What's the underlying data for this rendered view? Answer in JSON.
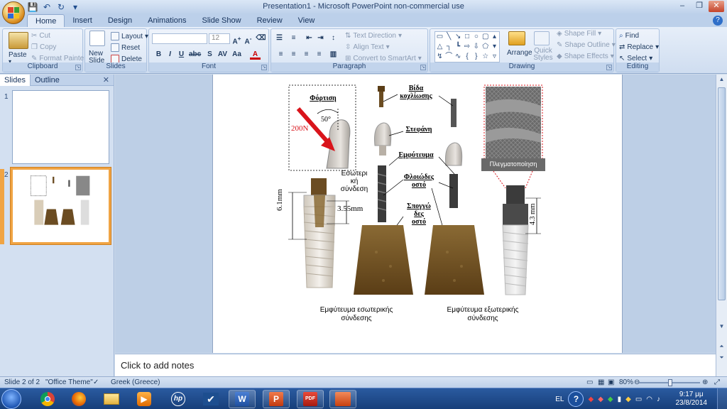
{
  "window": {
    "title": "Presentation1 - Microsoft PowerPoint non-commercial use"
  },
  "tabs": [
    "Home",
    "Insert",
    "Design",
    "Animations",
    "Slide Show",
    "Review",
    "View"
  ],
  "ribbon": {
    "clipboard": {
      "label": "Clipboard",
      "paste": "Paste",
      "cut": "Cut",
      "copy": "Copy",
      "format_painter": "Format Painter"
    },
    "slides": {
      "label": "Slides",
      "new_slide": "New Slide",
      "layout": "Layout",
      "reset": "Reset",
      "delete": "Delete"
    },
    "font": {
      "label": "Font",
      "size": "12"
    },
    "paragraph": {
      "label": "Paragraph",
      "text_direction": "Text Direction",
      "align_text": "Align Text",
      "convert_smartart": "Convert to SmartArt"
    },
    "drawing": {
      "label": "Drawing",
      "arrange": "Arrange",
      "quick_styles": "Quick Styles",
      "shape_fill": "Shape Fill",
      "shape_outline": "Shape Outline",
      "shape_effects": "Shape Effects"
    },
    "editing": {
      "label": "Editing",
      "find": "Find",
      "replace": "Replace",
      "select": "Select"
    }
  },
  "left_pane": {
    "tabs": [
      "Slides",
      "Outline"
    ],
    "thumbnails": [
      {
        "number": "1"
      },
      {
        "number": "2"
      }
    ]
  },
  "slide": {
    "labels": {
      "fortisi": "Φόρτιση",
      "load": "200N",
      "angle": "50°",
      "vida_line1": "Βίδα",
      "vida_line2": "κοχλίωσης",
      "stefani": "Στεφάνη",
      "emfyteuma": "Εμφύτευμα",
      "floiodes_line1": "Φλοιώδες",
      "floiodes_line2": "οστό",
      "spongodes_line1": "Σπογγώ",
      "spongodes_line2": "δες",
      "spongodes_line3": "οστό",
      "esoteriki_line1": "Εσωτερι",
      "esoteriki_line2": "κή",
      "esoteriki_line3": "σύνδεση",
      "dim_355": "3.55mm",
      "dim_61": "6.1mm",
      "dim_43_line1": "4.3",
      "dim_43_line2": "mm",
      "mesh_label": "Πλεγματοποίηση",
      "caption_internal_line1": "Εμφύτευμα εσωτερικής",
      "caption_internal_line2": "σύνδεσης",
      "caption_external_line1": "Εμφύτευμα εξωτερικής",
      "caption_external_line2": "σύνδεσης"
    }
  },
  "notes": {
    "placeholder": "Click to add notes"
  },
  "status": {
    "slide": "Slide 2 of 2",
    "theme": "\"Office Theme\"",
    "language": "Greek (Greece)",
    "zoom": "80%"
  },
  "taskbar": {
    "lang": "EL",
    "time": "9:17 μμ",
    "date": "23/8/2014"
  },
  "colors": {
    "accent": "#f0a444",
    "ribbon": "#dbe7f6",
    "arrow": "#d9141b",
    "bone": "#6b4c22"
  }
}
